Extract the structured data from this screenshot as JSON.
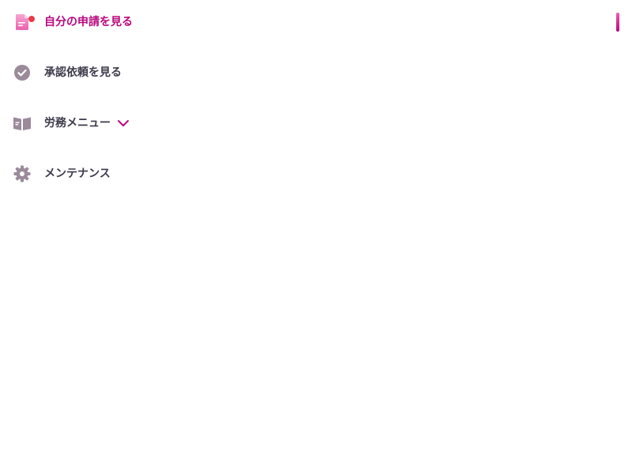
{
  "nav": {
    "items": [
      {
        "label": "自分の申請を見る",
        "icon": "document-icon",
        "active": true,
        "has_badge": true
      },
      {
        "label": "承認依頼を見る",
        "icon": "check-circle-icon",
        "active": false
      },
      {
        "label": "労務メニュー",
        "icon": "open-book-icon",
        "active": false,
        "expandable": true,
        "expand_icon": "chevron-down-icon"
      },
      {
        "label": "メンテナンス",
        "icon": "gear-icon",
        "active": false
      }
    ]
  },
  "colors": {
    "active_text": "#b8087e",
    "inactive_text": "#3d3a4a",
    "icon_inactive": "#9a8a9a",
    "badge": "#e83a4a",
    "indicator_gradient": [
      "#f25ab0",
      "#b8087e"
    ]
  }
}
